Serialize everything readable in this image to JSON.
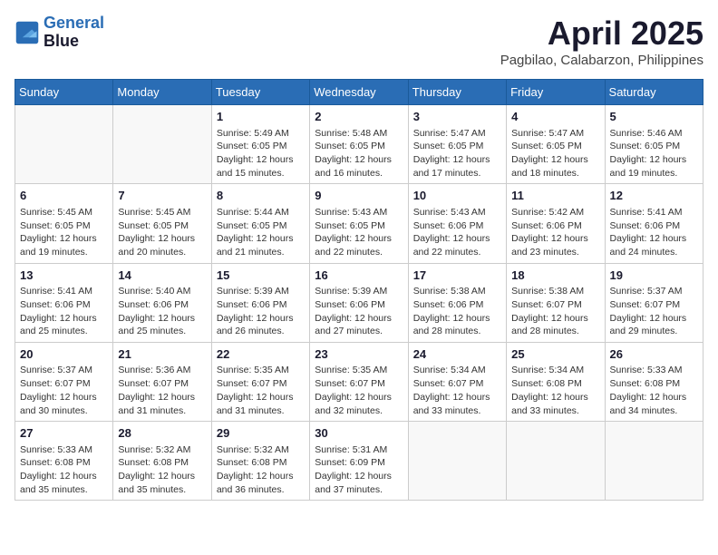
{
  "header": {
    "logo_line1": "General",
    "logo_line2": "Blue",
    "month_title": "April 2025",
    "location": "Pagbilao, Calabarzon, Philippines"
  },
  "weekdays": [
    "Sunday",
    "Monday",
    "Tuesday",
    "Wednesday",
    "Thursday",
    "Friday",
    "Saturday"
  ],
  "weeks": [
    [
      {
        "day": "",
        "info": ""
      },
      {
        "day": "",
        "info": ""
      },
      {
        "day": "1",
        "info": "Sunrise: 5:49 AM\nSunset: 6:05 PM\nDaylight: 12 hours and 15 minutes."
      },
      {
        "day": "2",
        "info": "Sunrise: 5:48 AM\nSunset: 6:05 PM\nDaylight: 12 hours and 16 minutes."
      },
      {
        "day": "3",
        "info": "Sunrise: 5:47 AM\nSunset: 6:05 PM\nDaylight: 12 hours and 17 minutes."
      },
      {
        "day": "4",
        "info": "Sunrise: 5:47 AM\nSunset: 6:05 PM\nDaylight: 12 hours and 18 minutes."
      },
      {
        "day": "5",
        "info": "Sunrise: 5:46 AM\nSunset: 6:05 PM\nDaylight: 12 hours and 19 minutes."
      }
    ],
    [
      {
        "day": "6",
        "info": "Sunrise: 5:45 AM\nSunset: 6:05 PM\nDaylight: 12 hours and 19 minutes."
      },
      {
        "day": "7",
        "info": "Sunrise: 5:45 AM\nSunset: 6:05 PM\nDaylight: 12 hours and 20 minutes."
      },
      {
        "day": "8",
        "info": "Sunrise: 5:44 AM\nSunset: 6:05 PM\nDaylight: 12 hours and 21 minutes."
      },
      {
        "day": "9",
        "info": "Sunrise: 5:43 AM\nSunset: 6:05 PM\nDaylight: 12 hours and 22 minutes."
      },
      {
        "day": "10",
        "info": "Sunrise: 5:43 AM\nSunset: 6:06 PM\nDaylight: 12 hours and 22 minutes."
      },
      {
        "day": "11",
        "info": "Sunrise: 5:42 AM\nSunset: 6:06 PM\nDaylight: 12 hours and 23 minutes."
      },
      {
        "day": "12",
        "info": "Sunrise: 5:41 AM\nSunset: 6:06 PM\nDaylight: 12 hours and 24 minutes."
      }
    ],
    [
      {
        "day": "13",
        "info": "Sunrise: 5:41 AM\nSunset: 6:06 PM\nDaylight: 12 hours and 25 minutes."
      },
      {
        "day": "14",
        "info": "Sunrise: 5:40 AM\nSunset: 6:06 PM\nDaylight: 12 hours and 25 minutes."
      },
      {
        "day": "15",
        "info": "Sunrise: 5:39 AM\nSunset: 6:06 PM\nDaylight: 12 hours and 26 minutes."
      },
      {
        "day": "16",
        "info": "Sunrise: 5:39 AM\nSunset: 6:06 PM\nDaylight: 12 hours and 27 minutes."
      },
      {
        "day": "17",
        "info": "Sunrise: 5:38 AM\nSunset: 6:06 PM\nDaylight: 12 hours and 28 minutes."
      },
      {
        "day": "18",
        "info": "Sunrise: 5:38 AM\nSunset: 6:07 PM\nDaylight: 12 hours and 28 minutes."
      },
      {
        "day": "19",
        "info": "Sunrise: 5:37 AM\nSunset: 6:07 PM\nDaylight: 12 hours and 29 minutes."
      }
    ],
    [
      {
        "day": "20",
        "info": "Sunrise: 5:37 AM\nSunset: 6:07 PM\nDaylight: 12 hours and 30 minutes."
      },
      {
        "day": "21",
        "info": "Sunrise: 5:36 AM\nSunset: 6:07 PM\nDaylight: 12 hours and 31 minutes."
      },
      {
        "day": "22",
        "info": "Sunrise: 5:35 AM\nSunset: 6:07 PM\nDaylight: 12 hours and 31 minutes."
      },
      {
        "day": "23",
        "info": "Sunrise: 5:35 AM\nSunset: 6:07 PM\nDaylight: 12 hours and 32 minutes."
      },
      {
        "day": "24",
        "info": "Sunrise: 5:34 AM\nSunset: 6:07 PM\nDaylight: 12 hours and 33 minutes."
      },
      {
        "day": "25",
        "info": "Sunrise: 5:34 AM\nSunset: 6:08 PM\nDaylight: 12 hours and 33 minutes."
      },
      {
        "day": "26",
        "info": "Sunrise: 5:33 AM\nSunset: 6:08 PM\nDaylight: 12 hours and 34 minutes."
      }
    ],
    [
      {
        "day": "27",
        "info": "Sunrise: 5:33 AM\nSunset: 6:08 PM\nDaylight: 12 hours and 35 minutes."
      },
      {
        "day": "28",
        "info": "Sunrise: 5:32 AM\nSunset: 6:08 PM\nDaylight: 12 hours and 35 minutes."
      },
      {
        "day": "29",
        "info": "Sunrise: 5:32 AM\nSunset: 6:08 PM\nDaylight: 12 hours and 36 minutes."
      },
      {
        "day": "30",
        "info": "Sunrise: 5:31 AM\nSunset: 6:09 PM\nDaylight: 12 hours and 37 minutes."
      },
      {
        "day": "",
        "info": ""
      },
      {
        "day": "",
        "info": ""
      },
      {
        "day": "",
        "info": ""
      }
    ]
  ]
}
